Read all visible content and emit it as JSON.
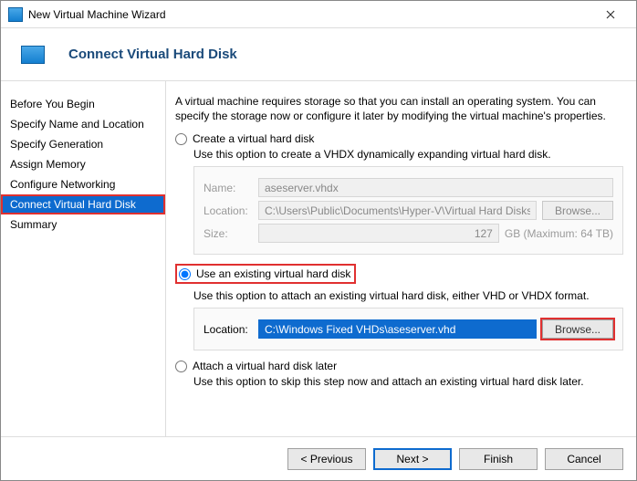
{
  "titlebar": {
    "title": "New Virtual Machine Wizard"
  },
  "header": {
    "title": "Connect Virtual Hard Disk"
  },
  "sidebar": {
    "items": [
      {
        "label": "Before You Begin"
      },
      {
        "label": "Specify Name and Location"
      },
      {
        "label": "Specify Generation"
      },
      {
        "label": "Assign Memory"
      },
      {
        "label": "Configure Networking"
      },
      {
        "label": "Connect Virtual Hard Disk"
      },
      {
        "label": "Summary"
      }
    ],
    "active_index": 5
  },
  "main": {
    "intro": "A virtual machine requires storage so that you can install an operating system. You can specify the storage now or configure it later by modifying the virtual machine's properties.",
    "opt_create": {
      "label": "Create a virtual hard disk",
      "desc": "Use this option to create a VHDX dynamically expanding virtual hard disk.",
      "name_label": "Name:",
      "name_value": "aseserver.vhdx",
      "loc_label": "Location:",
      "loc_value": "C:\\Users\\Public\\Documents\\Hyper-V\\Virtual Hard Disks\\",
      "browse": "Browse...",
      "size_label": "Size:",
      "size_value": "127",
      "size_unit": "GB (Maximum: 64 TB)"
    },
    "opt_existing": {
      "label": "Use an existing virtual hard disk",
      "desc": "Use this option to attach an existing virtual hard disk, either VHD or VHDX format.",
      "loc_label": "Location:",
      "loc_value": "C:\\Windows Fixed VHDs\\aseserver.vhd",
      "browse": "Browse..."
    },
    "opt_later": {
      "label": "Attach a virtual hard disk later",
      "desc": "Use this option to skip this step now and attach an existing virtual hard disk later."
    }
  },
  "footer": {
    "previous": "< Previous",
    "next": "Next >",
    "finish": "Finish",
    "cancel": "Cancel"
  }
}
